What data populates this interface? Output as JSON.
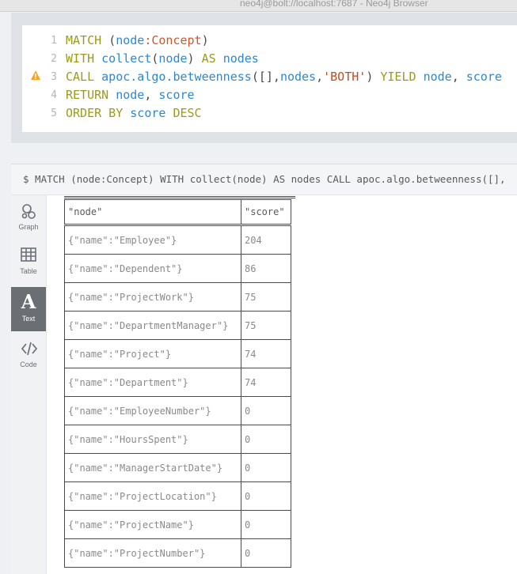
{
  "window": {
    "title": "neo4j@bolt://localhost:7687 - Neo4j Browser"
  },
  "editor": {
    "line_numbers": [
      "1",
      "2",
      "3",
      "4",
      "5"
    ],
    "lines": [
      [
        {
          "t": "MATCH ",
          "c": "kw"
        },
        {
          "t": "(",
          "c": "plain"
        },
        {
          "t": "node",
          "c": "var"
        },
        {
          "t": ":Concept",
          "c": "lbl"
        },
        {
          "t": ")",
          "c": "plain"
        }
      ],
      [
        {
          "t": "WITH ",
          "c": "kw"
        },
        {
          "t": "collect",
          "c": "var"
        },
        {
          "t": "(",
          "c": "plain"
        },
        {
          "t": "node",
          "c": "var"
        },
        {
          "t": ") ",
          "c": "plain"
        },
        {
          "t": "AS ",
          "c": "kw"
        },
        {
          "t": "nodes",
          "c": "var"
        }
      ],
      [
        {
          "t": "CALL ",
          "c": "kw"
        },
        {
          "t": "apoc.algo.betweenness",
          "c": "var"
        },
        {
          "t": "([],",
          "c": "plain"
        },
        {
          "t": "nodes",
          "c": "var"
        },
        {
          "t": ",",
          "c": "plain"
        },
        {
          "t": "'BOTH'",
          "c": "str"
        },
        {
          "t": ") ",
          "c": "plain"
        },
        {
          "t": "YIELD ",
          "c": "kw"
        },
        {
          "t": "node",
          "c": "var"
        },
        {
          "t": ", ",
          "c": "plain"
        },
        {
          "t": "score",
          "c": "var"
        }
      ],
      [
        {
          "t": "RETURN ",
          "c": "kw"
        },
        {
          "t": "node",
          "c": "var"
        },
        {
          "t": ", ",
          "c": "plain"
        },
        {
          "t": "score",
          "c": "var"
        }
      ],
      [
        {
          "t": "ORDER BY ",
          "c": "kw"
        },
        {
          "t": "score ",
          "c": "var"
        },
        {
          "t": "DESC",
          "c": "kw"
        }
      ]
    ],
    "warning_icon": "warning-icon",
    "warning_color": "#f5a623"
  },
  "result": {
    "command": "$ MATCH (node:Concept) WITH collect(node) AS nodes CALL apoc.algo.betweenness([],"
  },
  "sidebar": {
    "items": [
      {
        "label": "Graph",
        "icon": "graph-icon",
        "active": false
      },
      {
        "label": "Table",
        "icon": "table-icon",
        "active": false
      },
      {
        "label": "Text",
        "icon": "text-icon",
        "active": true
      },
      {
        "label": "Code",
        "icon": "code-icon",
        "active": false
      }
    ],
    "text_glyph": "A"
  },
  "table": {
    "headers": [
      "\"node\"",
      "\"score\""
    ],
    "rows": [
      [
        "{\"name\":\"Employee\"}",
        "204"
      ],
      [
        "{\"name\":\"Dependent\"}",
        "86"
      ],
      [
        "{\"name\":\"ProjectWork\"}",
        "75"
      ],
      [
        "{\"name\":\"DepartmentManager\"}",
        "75"
      ],
      [
        "{\"name\":\"Project\"}",
        "74"
      ],
      [
        "{\"name\":\"Department\"}",
        "74"
      ],
      [
        "{\"name\":\"EmployeeNumber\"}",
        "0"
      ],
      [
        "{\"name\":\"HoursSpent\"}",
        "0"
      ],
      [
        "{\"name\":\"ManagerStartDate\"}",
        "0"
      ],
      [
        "{\"name\":\"ProjectLocation\"}",
        "0"
      ],
      [
        "{\"name\":\"ProjectName\"}",
        "0"
      ],
      [
        "{\"name\":\"ProjectNumber\"}",
        "0"
      ]
    ]
  }
}
